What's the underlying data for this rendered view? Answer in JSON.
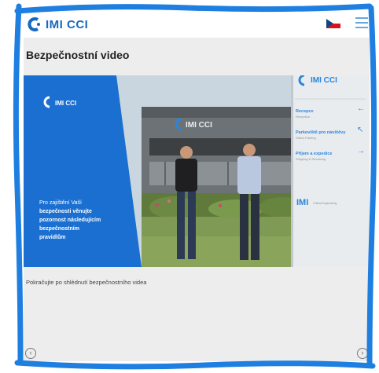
{
  "header": {
    "logo_text": "IMI CCI",
    "menu_icon": "hamburger-icon",
    "flag_icon": "czech-flag-icon"
  },
  "page": {
    "title": "Bezpečnostní video",
    "caption": "Pokračujte po shlédnutí bezpečnostního videa"
  },
  "video": {
    "overlay_logo": "IMI CCI",
    "overlay_lines": [
      "Pro zajištění Vaší",
      "bezpečnosti věnujte",
      "pozornost následujícím",
      "bezpečnostním",
      "pravidlům"
    ],
    "building_sign": "IMI CCI",
    "sign_top": "IMI CCI",
    "sign_items": [
      {
        "main": "Recepce",
        "sub": "Reception"
      },
      {
        "main": "Parkoviště pro návštěvy",
        "sub": "Visitor Parking"
      },
      {
        "main": "Příjem a expedice",
        "sub": "Shipping & Receiving"
      }
    ],
    "sign_bottom": "IMI",
    "sign_bottom_small": "Critical Engineering"
  },
  "nav": {
    "prev_icon": "chevron-left-icon",
    "next_icon": "chevron-right-icon"
  },
  "colors": {
    "brand_blue": "#1569c0",
    "frame_blue": "#1e7fe0",
    "panel_blue": "#1a6fd0"
  }
}
